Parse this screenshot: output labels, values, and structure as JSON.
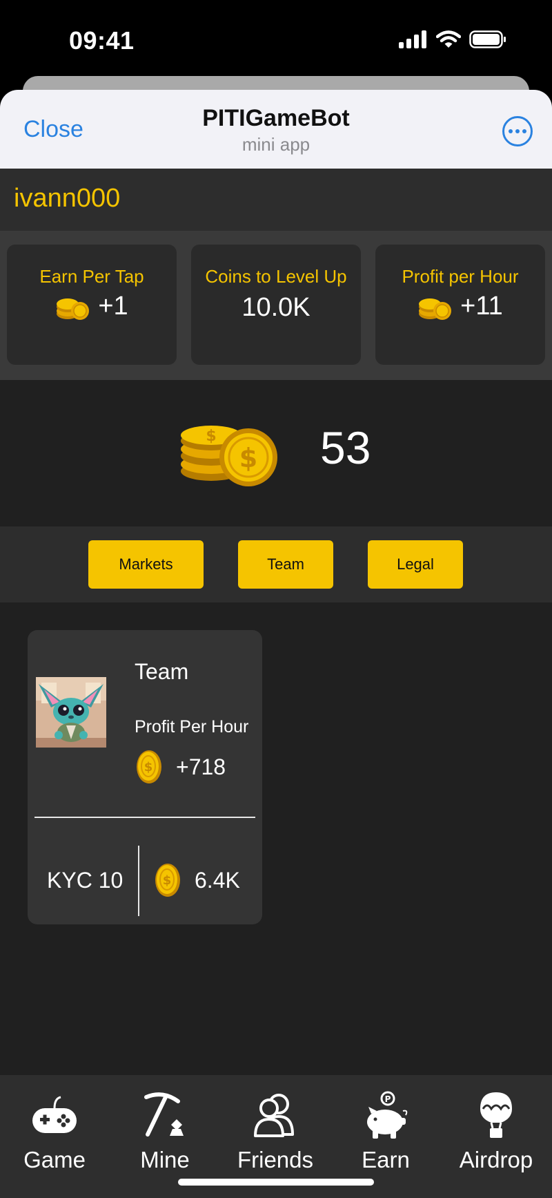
{
  "status_bar": {
    "time": "09:41"
  },
  "header": {
    "close_label": "Close",
    "title": "PITIGameBot",
    "subtitle": "mini app"
  },
  "user": {
    "name": "ivann000"
  },
  "stats": [
    {
      "label": "Earn Per Tap",
      "value": "+1"
    },
    {
      "label": "Coins to Level Up",
      "value": "10.0K"
    },
    {
      "label": "Profit per Hour",
      "value": "+11"
    }
  ],
  "balance": {
    "value": "53"
  },
  "tabs": [
    {
      "label": "Markets"
    },
    {
      "label": "Team"
    },
    {
      "label": "Legal"
    }
  ],
  "card": {
    "title": "Team",
    "profit_label": "Profit Per Hour",
    "profit_value": "+718",
    "level": "KYC 10",
    "cost": "6.4K"
  },
  "nav": [
    {
      "label": "Game",
      "icon": "gamepad-icon"
    },
    {
      "label": "Mine",
      "icon": "pickaxe-icon"
    },
    {
      "label": "Friends",
      "icon": "friends-icon"
    },
    {
      "label": "Earn",
      "icon": "piggy-bank-icon"
    },
    {
      "label": "Airdrop",
      "icon": "airdrop-icon"
    }
  ],
  "colors": {
    "accent": "#f5c400",
    "link": "#2a82e0",
    "background": "#202020"
  }
}
